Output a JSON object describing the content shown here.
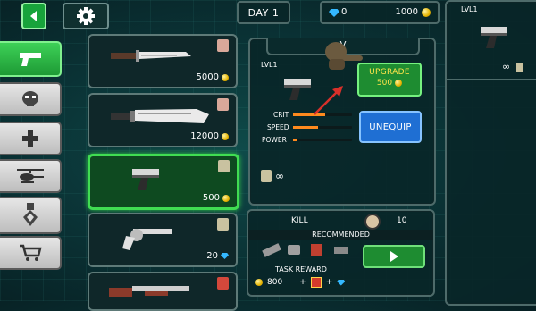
{
  "header": {
    "day": "DAY 1",
    "gems": "0",
    "coins": "1000"
  },
  "icons": {
    "back": "back-arrow-icon",
    "settings": "gear-icon",
    "categories": [
      "pistol-icon",
      "skull-mask-icon",
      "medkit-cross-icon",
      "helicopter-icon",
      "medal-icon",
      "shopping-cart-icon"
    ]
  },
  "weapons": [
    {
      "name": "combat-knife",
      "price": "5000",
      "currency": "coin"
    },
    {
      "name": "machete",
      "price": "12000",
      "currency": "coin"
    },
    {
      "name": "pistol",
      "price": "500",
      "currency": "coin"
    },
    {
      "name": "revolver",
      "price": "20",
      "currency": "gem"
    },
    {
      "name": "shotgun",
      "price": "",
      "currency": "coin"
    }
  ],
  "detail": {
    "title_fragment": "V",
    "level": "LVL1",
    "upgrade_label": "UPGRADE",
    "upgrade_price": "500",
    "unequip_label": "UNEQUIP",
    "stats": [
      {
        "label": "CRIT",
        "value": 0.55
      },
      {
        "label": "SPEED",
        "value": 0.42
      },
      {
        "label": "POWER",
        "value": 0.08
      }
    ],
    "ammo": "∞"
  },
  "mission": {
    "kill_label": "KILL",
    "kill_count": "10",
    "recommended_label": "RECOMMENDED",
    "task_reward_label": "TASK REWARD",
    "reward_coins": "800",
    "plus1": "+",
    "plus2": "+"
  },
  "equipped": {
    "level": "LVL1",
    "ammo": "∞"
  },
  "colors": {
    "accent_green": "#37d24c",
    "upgrade_text": "#ffe44a",
    "unequip_blue": "#1f6fd3",
    "stat_fill": "#ff8a1e"
  }
}
